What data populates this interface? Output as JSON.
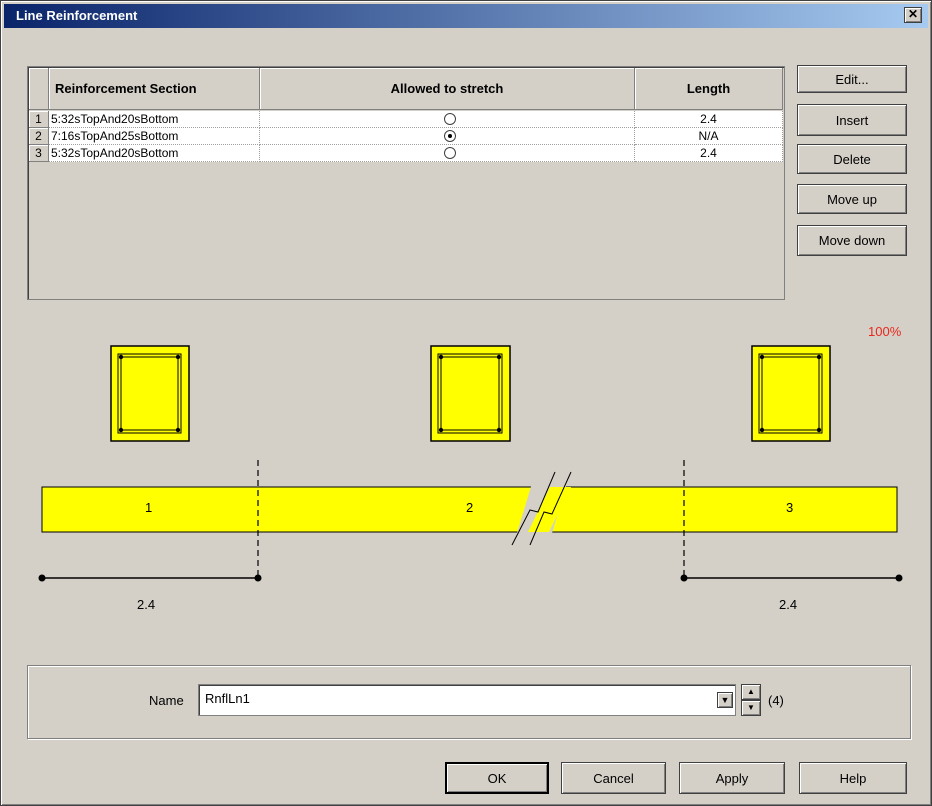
{
  "window": {
    "title": "Line Reinforcement",
    "close_glyph": "✕"
  },
  "grid": {
    "headers": [
      "Reinforcement Section",
      "Allowed to stretch",
      "Length"
    ],
    "rows": [
      {
        "num": "1",
        "section": "5:32sTopAnd20sBottom",
        "stretch": false,
        "length": "2.4"
      },
      {
        "num": "2",
        "section": "7:16sTopAnd25sBottom",
        "stretch": true,
        "length": "N/A"
      },
      {
        "num": "3",
        "section": "5:32sTopAnd20sBottom",
        "stretch": false,
        "length": "2.4"
      }
    ]
  },
  "side_buttons": {
    "edit": "Edit...",
    "insert": "Insert",
    "delete": "Delete",
    "move_up": "Move up",
    "move_down": "Move down"
  },
  "preview": {
    "zoom": "100%",
    "segments": [
      "1",
      "2",
      "3"
    ],
    "dims": [
      "2.4",
      "2.4"
    ],
    "colors": {
      "section_fill": "#ffff00",
      "zoom_text": "#e8281e"
    }
  },
  "name_group": {
    "label": "Name",
    "value": "RnflLn1",
    "count": "(4)"
  },
  "footer": {
    "ok": "OK",
    "cancel": "Cancel",
    "apply": "Apply",
    "help": "Help"
  }
}
